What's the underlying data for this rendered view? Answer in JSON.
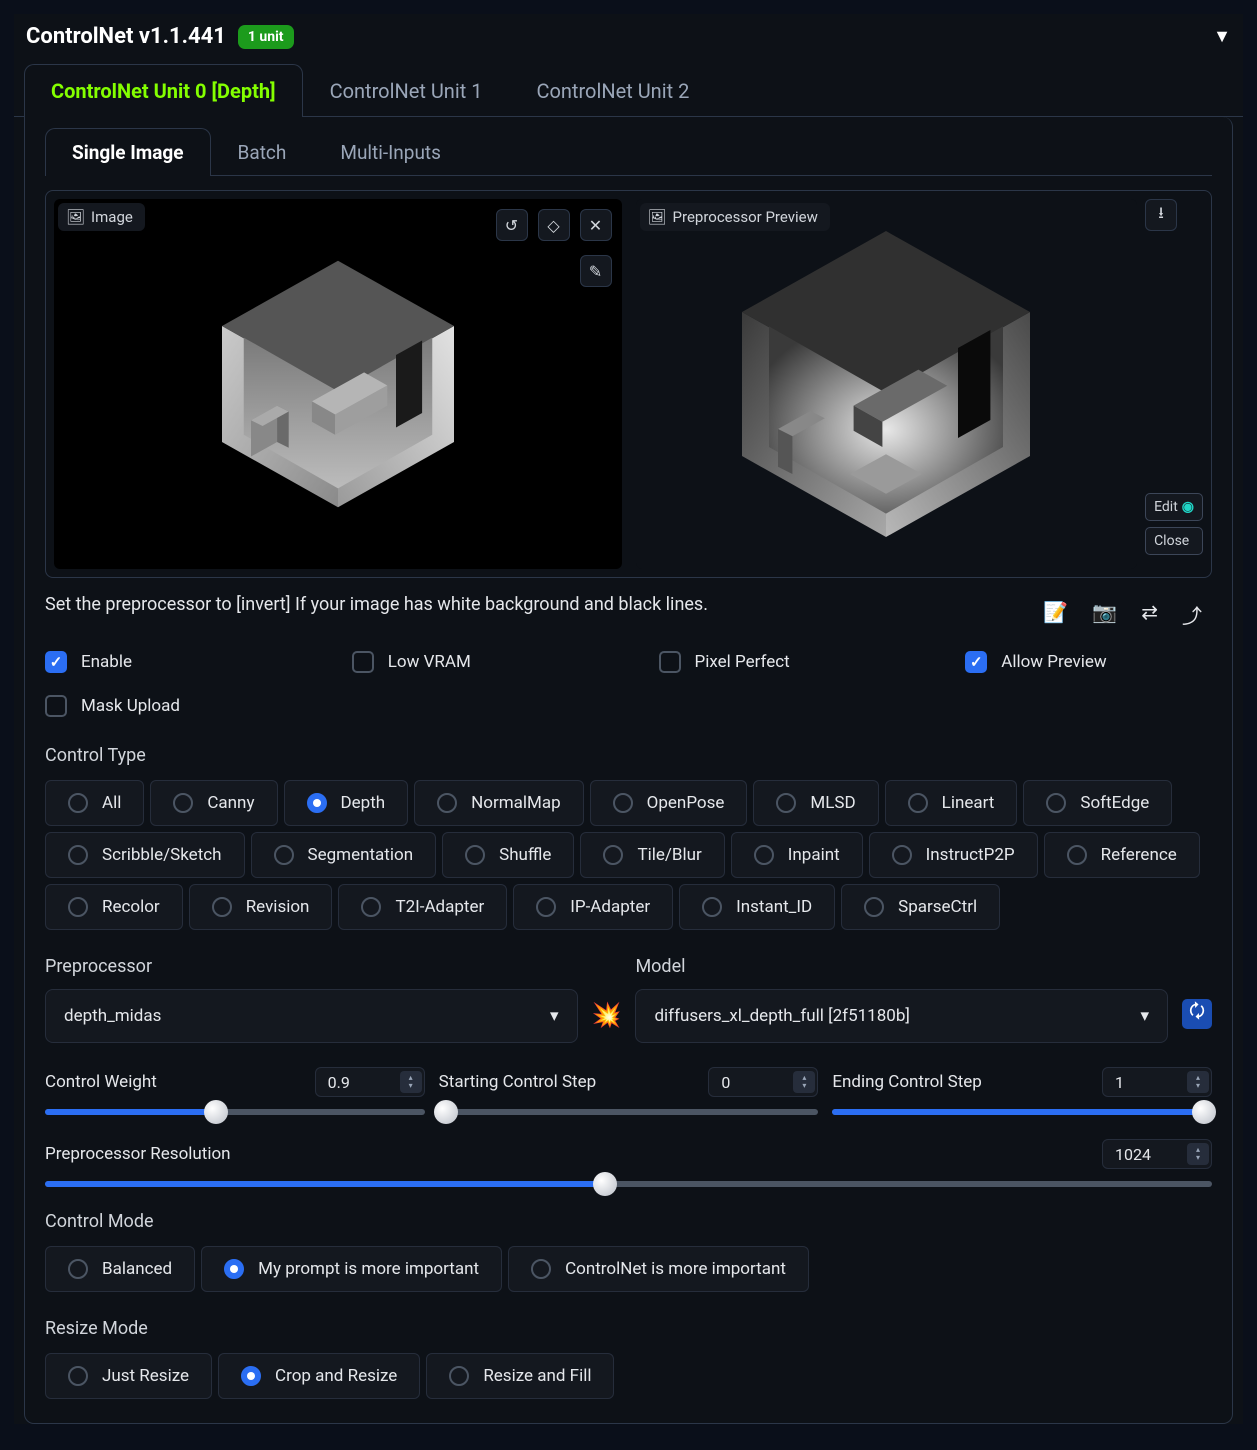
{
  "header": {
    "title": "ControlNet v1.1.441",
    "badge": "1 unit"
  },
  "unit_tabs": [
    {
      "label": "ControlNet Unit 0 [Depth]",
      "active": true
    },
    {
      "label": "ControlNet Unit 1",
      "active": false
    },
    {
      "label": "ControlNet Unit 2",
      "active": false
    }
  ],
  "image_tabs": [
    {
      "label": "Single Image",
      "active": true
    },
    {
      "label": "Batch",
      "active": false
    },
    {
      "label": "Multi-Inputs",
      "active": false
    }
  ],
  "image_panel": {
    "input_label": "Image",
    "preview_label": "Preprocessor Preview",
    "edit_btn": "Edit",
    "close_btn": "Close"
  },
  "hint": "Set the preprocessor to [invert] If your image has white background and black lines.",
  "checkboxes": {
    "enable": {
      "label": "Enable",
      "checked": true
    },
    "low_vram": {
      "label": "Low VRAM",
      "checked": false
    },
    "pixel_perfect": {
      "label": "Pixel Perfect",
      "checked": false
    },
    "allow_preview": {
      "label": "Allow Preview",
      "checked": true
    },
    "mask_upload": {
      "label": "Mask Upload",
      "checked": false
    }
  },
  "control_type": {
    "label": "Control Type",
    "selected": "Depth",
    "options": [
      "All",
      "Canny",
      "Depth",
      "NormalMap",
      "OpenPose",
      "MLSD",
      "Lineart",
      "SoftEdge",
      "Scribble/Sketch",
      "Segmentation",
      "Shuffle",
      "Tile/Blur",
      "Inpaint",
      "InstructP2P",
      "Reference",
      "Recolor",
      "Revision",
      "T2I-Adapter",
      "IP-Adapter",
      "Instant_ID",
      "SparseCtrl"
    ]
  },
  "preprocessor": {
    "label": "Preprocessor",
    "value": "depth_midas"
  },
  "model": {
    "label": "Model",
    "value": "diffusers_xl_depth_full [2f51180b]"
  },
  "sliders": {
    "control_weight": {
      "label": "Control Weight",
      "value": "0.9",
      "fill_pct": 45
    },
    "start_step": {
      "label": "Starting Control Step",
      "value": "0",
      "fill_pct": 0
    },
    "end_step": {
      "label": "Ending Control Step",
      "value": "1",
      "fill_pct": 100
    },
    "preproc_res": {
      "label": "Preprocessor Resolution",
      "value": "1024",
      "fill_pct": 48
    }
  },
  "control_mode": {
    "label": "Control Mode",
    "selected": "My prompt is more important",
    "options": [
      "Balanced",
      "My prompt is more important",
      "ControlNet is more important"
    ]
  },
  "resize_mode": {
    "label": "Resize Mode",
    "selected": "Crop and Resize",
    "options": [
      "Just Resize",
      "Crop and Resize",
      "Resize and Fill"
    ]
  }
}
